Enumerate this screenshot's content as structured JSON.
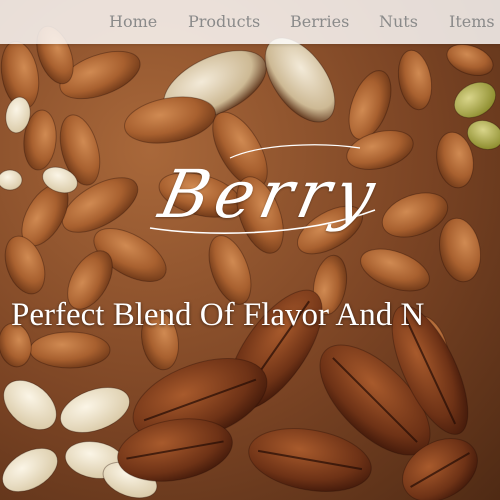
{
  "nav": {
    "items": [
      {
        "label": "Home"
      },
      {
        "label": "Products"
      },
      {
        "label": "Berries"
      },
      {
        "label": "Nuts"
      },
      {
        "label": "Items"
      }
    ]
  },
  "hero": {
    "brand": "Berry",
    "tagline": "Perfect Blend Of Flavor And N"
  },
  "colors": {
    "nav_background": "#ffffff",
    "nav_text": "#8a8a8a",
    "hero_text": "#ffffff",
    "almond": "#b06a36",
    "pecan": "#7a3c1b",
    "cashew": "#f0e6cf",
    "pistachio": "#b7b34a"
  },
  "icons": {
    "background": "mixed-nuts-photo"
  }
}
